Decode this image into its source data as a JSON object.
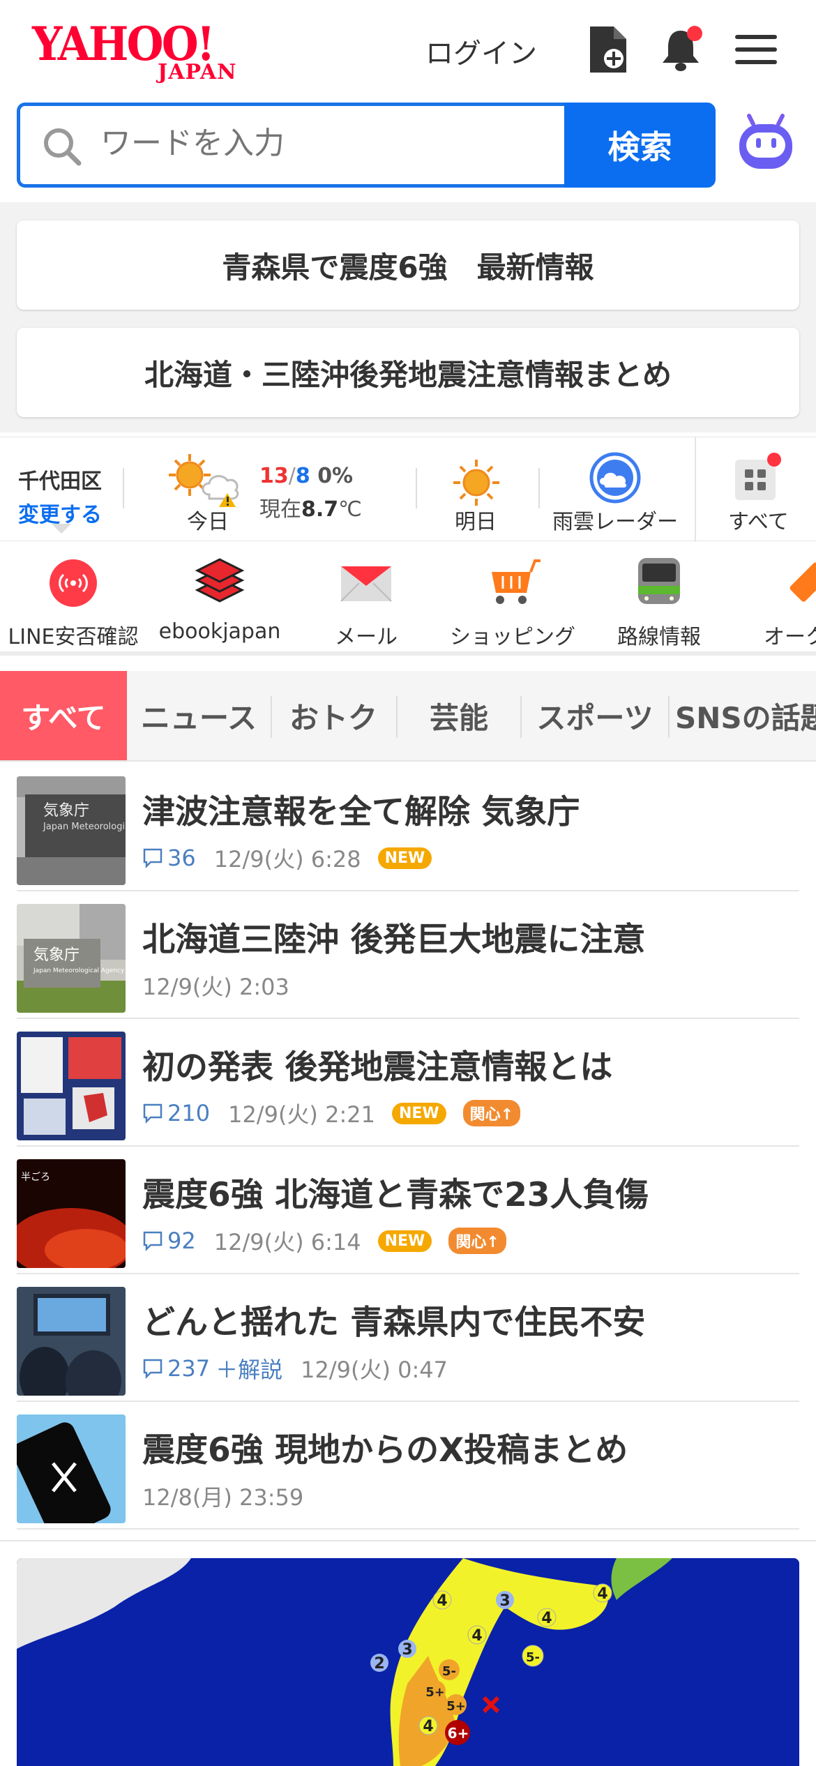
{
  "header": {
    "logo_main": "YAHOO!",
    "logo_sub": "JAPAN",
    "login_label": "ログイン",
    "icons": [
      "add-document-icon",
      "bell-icon",
      "menu-icon"
    ]
  },
  "search": {
    "placeholder": "ワードを入力",
    "button_label": "検索"
  },
  "alerts": [
    {
      "label": "青森県で震度6強　最新情報"
    },
    {
      "label": "北海道・三陸沖後発地震注意情報まとめ"
    }
  ],
  "weather": {
    "location": "千代田区",
    "change_label": "変更する",
    "today_label": "今日",
    "high": "13",
    "slash": "/",
    "low": "8",
    "rain": "0%",
    "current_prefix": "現在",
    "current_temp": "8.7",
    "current_unit": "℃",
    "tomorrow_label": "明日",
    "radar_label": "雨雲レーダー",
    "all_label": "すべて"
  },
  "services": [
    {
      "label": "LINE安否確認",
      "icon": "line-safety-icon"
    },
    {
      "label": "ebookjapan",
      "icon": "books-icon"
    },
    {
      "label": "メール",
      "icon": "mail-icon"
    },
    {
      "label": "ショッピング",
      "icon": "cart-icon"
    },
    {
      "label": "路線情報",
      "icon": "train-icon"
    },
    {
      "label": "オークシ",
      "icon": "auction-icon"
    }
  ],
  "tabs": [
    {
      "label": "すべて"
    },
    {
      "label": "ニュース"
    },
    {
      "label": "おトク"
    },
    {
      "label": "芸能"
    },
    {
      "label": "スポーツ"
    },
    {
      "label": "SNSの話題"
    }
  ],
  "news": [
    {
      "title": "津波注意報を全て解除 気象庁",
      "comments": "36",
      "time": "12/9(火) 6:28",
      "new_badge": "NEW",
      "thumb_text": "気象庁",
      "thumb_sub": "Japan Meteorologi"
    },
    {
      "title": "北海道三陸沖 後発巨大地震に注意",
      "time": "12/9(火) 2:03",
      "thumb_text": "気象庁",
      "thumb_sub": "Japan Meteorological Agency"
    },
    {
      "title": "初の発表 後発地震注意情報とは",
      "comments": "210",
      "time": "12/9(火) 2:21",
      "new_badge": "NEW",
      "hot_badge": "関心↑"
    },
    {
      "title": "震度6強 北海道と青森で23人負傷",
      "comments": "92",
      "time": "12/9(火) 6:14",
      "new_badge": "NEW",
      "hot_badge": "関心↑",
      "thumb_text": "半ごろ"
    },
    {
      "title": "どんと揺れた 青森県内で住民不安",
      "comments": "237",
      "explain": "＋解説",
      "time": "12/9(火) 0:47"
    },
    {
      "title": "震度6強 現地からのX投稿まとめ",
      "time": "12/8(月) 23:59"
    }
  ],
  "map": {
    "intensity_labels": [
      "2",
      "3",
      "4",
      "5-",
      "5+",
      "6+"
    ]
  }
}
